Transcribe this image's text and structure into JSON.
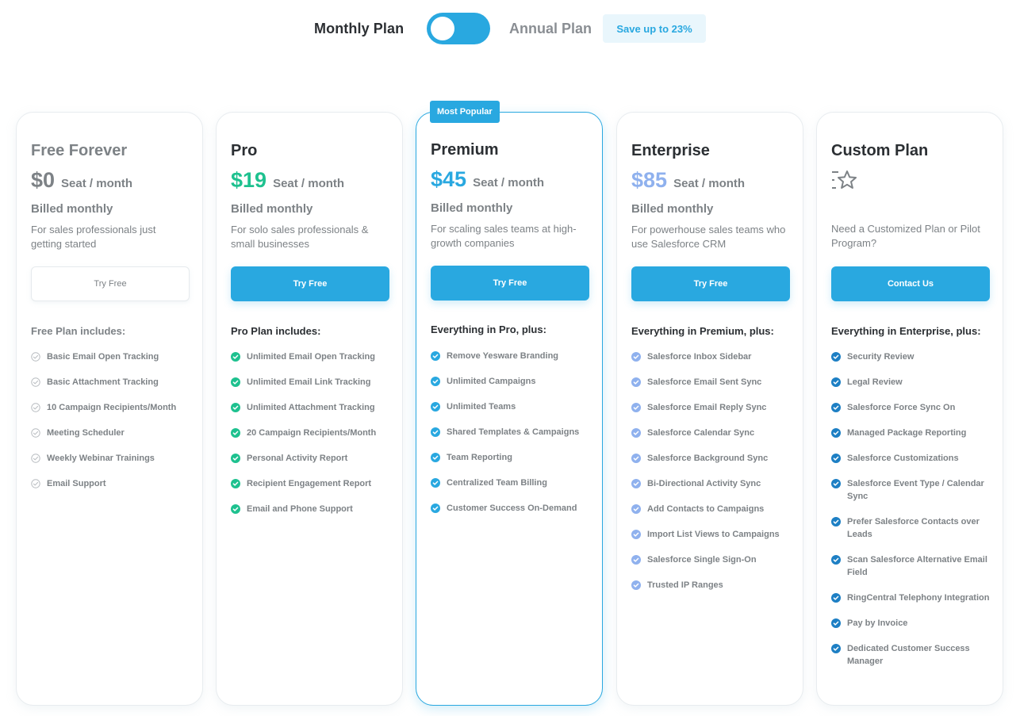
{
  "billing_toggle": {
    "monthly_label": "Monthly Plan",
    "annual_label": "Annual Plan",
    "selected": "monthly",
    "save_badge": "Save up to 23%"
  },
  "colors": {
    "accent": "#29a8e0",
    "free_price": "#7d8286",
    "pro_price": "#1ec18f",
    "premium_price": "#29a8e0",
    "enterprise_price": "#8fb1ee",
    "free_check": "#b9bdc1",
    "pro_check": "#1ec18f",
    "premium_check": "#29a8e0",
    "enterprise_check": "#8fb1ee",
    "custom_check": "#1d7fc4"
  },
  "plans": [
    {
      "name": "Free Forever",
      "price": "$0",
      "per": "Seat / month",
      "billed": "Billed monthly",
      "description": "For sales professionals just getting started",
      "cta": "Try Free",
      "features_title": "Free Plan includes:",
      "features": [
        "Basic Email Open Tracking",
        "Basic Attachment Tracking",
        "10 Campaign Recipients/Month",
        "Meeting Scheduler",
        "Weekly Webinar Trainings",
        "Email Support"
      ]
    },
    {
      "name": "Pro",
      "price": "$19",
      "per": "Seat / month",
      "billed": "Billed monthly",
      "description": "For solo sales professionals & small businesses",
      "cta": "Try Free",
      "features_title": "Pro Plan includes:",
      "features": [
        "Unlimited Email Open Tracking",
        "Unlimited Email Link Tracking",
        "Unlimited Attachment Tracking",
        "20 Campaign Recipients/Month",
        "Personal Activity Report",
        "Recipient Engagement Report",
        "Email and Phone Support"
      ]
    },
    {
      "name": "Premium",
      "badge": "Most Popular",
      "price": "$45",
      "per": "Seat / month",
      "billed": "Billed monthly",
      "description": "For scaling sales teams at high-growth companies",
      "cta": "Try Free",
      "features_title": "Everything in Pro, plus:",
      "features": [
        "Remove Yesware Branding",
        "Unlimited Campaigns",
        "Unlimited Teams",
        "Shared Templates & Campaigns",
        "Team Reporting",
        "Centralized Team Billing",
        "Customer Success On-Demand"
      ]
    },
    {
      "name": "Enterprise",
      "price": "$85",
      "per": "Seat / month",
      "billed": "Billed monthly",
      "description": "For powerhouse sales teams who use Salesforce CRM",
      "cta": "Try Free",
      "features_title": "Everything in Premium, plus:",
      "features": [
        "Salesforce Inbox Sidebar",
        "Salesforce Email Sent Sync",
        "Salesforce Email Reply Sync",
        "Salesforce Calendar Sync",
        "Salesforce Background Sync",
        "Bi-Directional Activity Sync",
        "Add Contacts to Campaigns",
        "Import List Views to Campaigns",
        "Salesforce Single Sign-On",
        "Trusted IP Ranges"
      ]
    },
    {
      "name": "Custom Plan",
      "icon": "star-list-icon",
      "description": "Need a Customized Plan or Pilot Program?",
      "cta": "Contact Us",
      "features_title": "Everything in Enterprise, plus:",
      "features": [
        "Security Review",
        "Legal Review",
        "Salesforce Force Sync On",
        "Managed Package Reporting",
        "Salesforce Customizations",
        "Salesforce Event Type / Calendar Sync",
        "Prefer Salesforce Contacts over Leads",
        "Scan Salesforce Alternative Email Field",
        "RingCentral Telephony Integration",
        "Pay by Invoice",
        "Dedicated Customer Success Manager"
      ]
    }
  ]
}
